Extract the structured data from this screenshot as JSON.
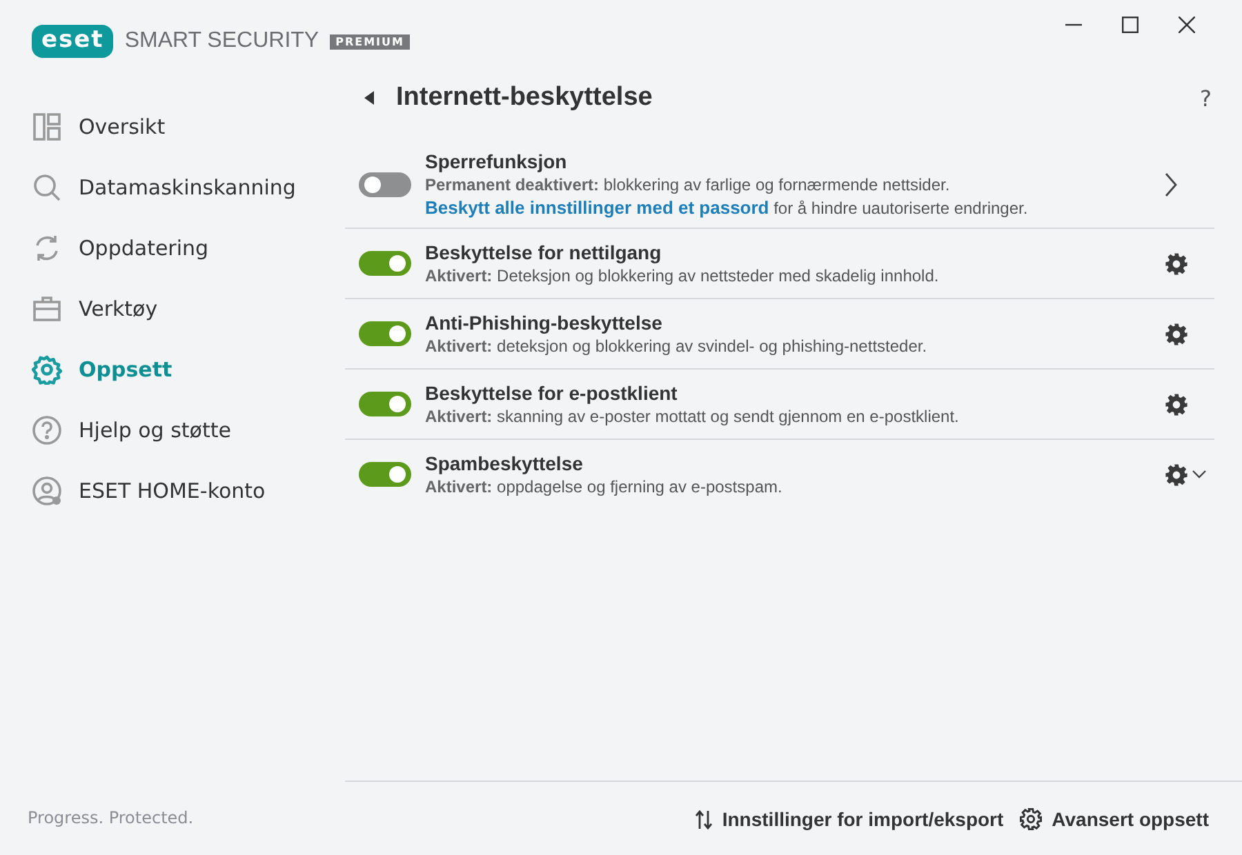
{
  "brand": {
    "logo": "eset",
    "product": "SMART SECURITY",
    "edition": "PREMIUM"
  },
  "sidebar": {
    "items": [
      {
        "label": "Oversikt",
        "selected": false
      },
      {
        "label": "Datamaskinskanning",
        "selected": false
      },
      {
        "label": "Oppdatering",
        "selected": false
      },
      {
        "label": "Verktøy",
        "selected": false
      },
      {
        "label": "Oppsett",
        "selected": true
      },
      {
        "label": "Hjelp og støtte",
        "selected": false
      },
      {
        "label": "ESET HOME-konto",
        "selected": false
      }
    ],
    "tagline": "Progress. Protected."
  },
  "page": {
    "title": "Internett-beskyttelse",
    "help": "?"
  },
  "features": [
    {
      "title": "Sperrefunksjon",
      "on": false,
      "description": "**Permanent deaktivert:** blokkering av farlige og fornærmende nettsider.",
      "link": "Beskytt alle innstillinger med et passord",
      "link_suffix": " for å hindre uautoriserte endringer.",
      "kind": "chevron"
    },
    {
      "title": "Beskyttelse for nettilgang",
      "on": true,
      "description": "**Aktivert:** Deteksjon og blokkering av nettsteder med skadelig innhold.",
      "kind": "gear"
    },
    {
      "title": "Anti-Phishing-beskyttelse",
      "on": true,
      "description": "**Aktivert:** deteksjon og blokkering av svindel- og phishing-nettsteder.",
      "kind": "gear"
    },
    {
      "title": "Beskyttelse for e-postklient",
      "on": true,
      "description": "**Aktivert:** skanning av e-poster mottatt og sendt gjennom en e-postklient.",
      "kind": "gear"
    },
    {
      "title": "Spambeskyttelse",
      "on": true,
      "description": "**Aktivert:** oppdagelse og fjerning av e-postspam.",
      "kind": "menu"
    }
  ],
  "footer": {
    "buttons": [
      {
        "label": "Innstillinger for import/eksport"
      },
      {
        "label": "Avansert oppsett"
      }
    ]
  }
}
